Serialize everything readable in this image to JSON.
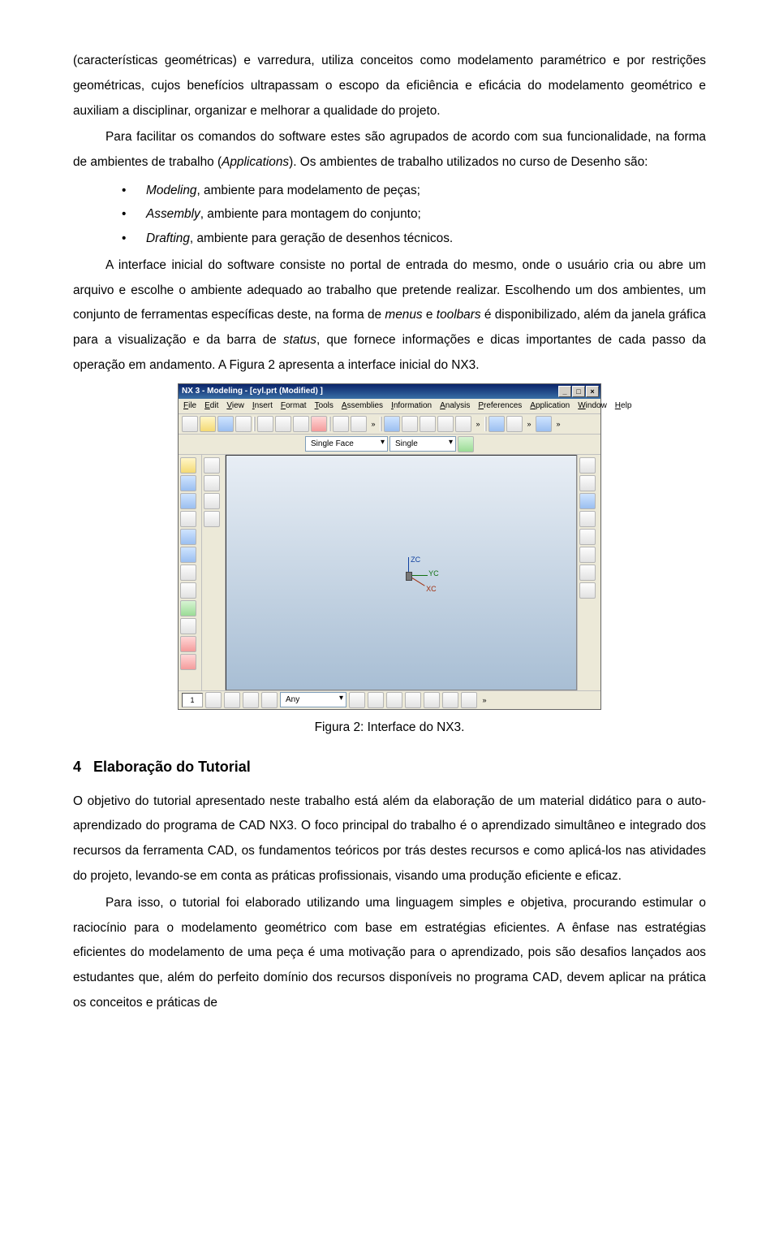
{
  "paragraphs": {
    "p1_a": "(características geométricas) e varredura, utiliza conceitos como modelamento paramétrico e por restrições geométricas, cujos benefícios ultrapassam o escopo da eficiência e eficácia do modelamento geométrico e auxiliam a disciplinar, organizar e melhorar a qualidade do projeto.",
    "p2_a": "Para facilitar os comandos do software estes são agrupados de acordo com sua funcionalidade, na forma de ambientes de trabalho (",
    "p2_b": "Applications",
    "p2_c": "). Os ambientes de trabalho utilizados no curso de Desenho são:",
    "bullet1_a": "Modeling",
    "bullet1_b": ", ambiente para modelamento de peças;",
    "bullet2_a": "Assembly",
    "bullet2_b": ", ambiente para montagem do conjunto;",
    "bullet3_a": "Drafting",
    "bullet3_b": ", ambiente para geração de desenhos técnicos.",
    "p3_a": "A interface inicial do software consiste no portal de entrada do mesmo, onde o usuário cria ou abre um arquivo e escolhe o ambiente adequado ao trabalho que pretende realizar. Escolhendo um dos ambientes, um conjunto de ferramentas específicas deste, na forma de ",
    "p3_b": "menus",
    "p3_c": " e ",
    "p3_d": "toolbars",
    "p3_e": " é disponibilizado, além da janela gráfica para a visualização e da barra de ",
    "p3_f": "status",
    "p3_g": ", que fornece informações e dicas importantes de cada passo da operação em andamento. A Figura 2 apresenta a interface inicial do NX3.",
    "figcaption": "Figura 2: Interface do NX3.",
    "section_num": "4",
    "section_title": "Elaboração do Tutorial",
    "p4": "O objetivo do tutorial apresentado neste trabalho está além da elaboração de um material didático para o auto-aprendizado do programa de CAD NX3. O foco principal do trabalho é o aprendizado simultâneo e integrado dos recursos da ferramenta CAD, os fundamentos teóricos por trás destes recursos e como aplicá-los nas atividades do projeto, levando-se em conta as práticas profissionais, visando uma produção eficiente e eficaz.",
    "p5": "Para isso, o tutorial foi elaborado utilizando uma linguagem simples e objetiva, procurando estimular o raciocínio para o modelamento geométrico com base em estratégias eficientes. A ênfase nas estratégias eficientes do modelamento de uma peça é uma motivação para o aprendizado, pois são desafios lançados aos estudantes que, além do perfeito domínio dos recursos disponíveis no programa CAD, devem aplicar na prática os conceitos e práticas de"
  },
  "nx3": {
    "title": "NX 3 - Modeling - [cyl.prt (Modified) ]",
    "menubar": [
      "File",
      "Edit",
      "View",
      "Insert",
      "Format",
      "Tools",
      "Assemblies",
      "Information",
      "Analysis",
      "Preferences",
      "Application",
      "Window",
      "Help"
    ],
    "sel1": "Single Face",
    "sel2": "Single",
    "status_field1": "1",
    "status_any": "Any",
    "coord_z": "ZC",
    "coord_y": "YC",
    "coord_x": "XC"
  }
}
